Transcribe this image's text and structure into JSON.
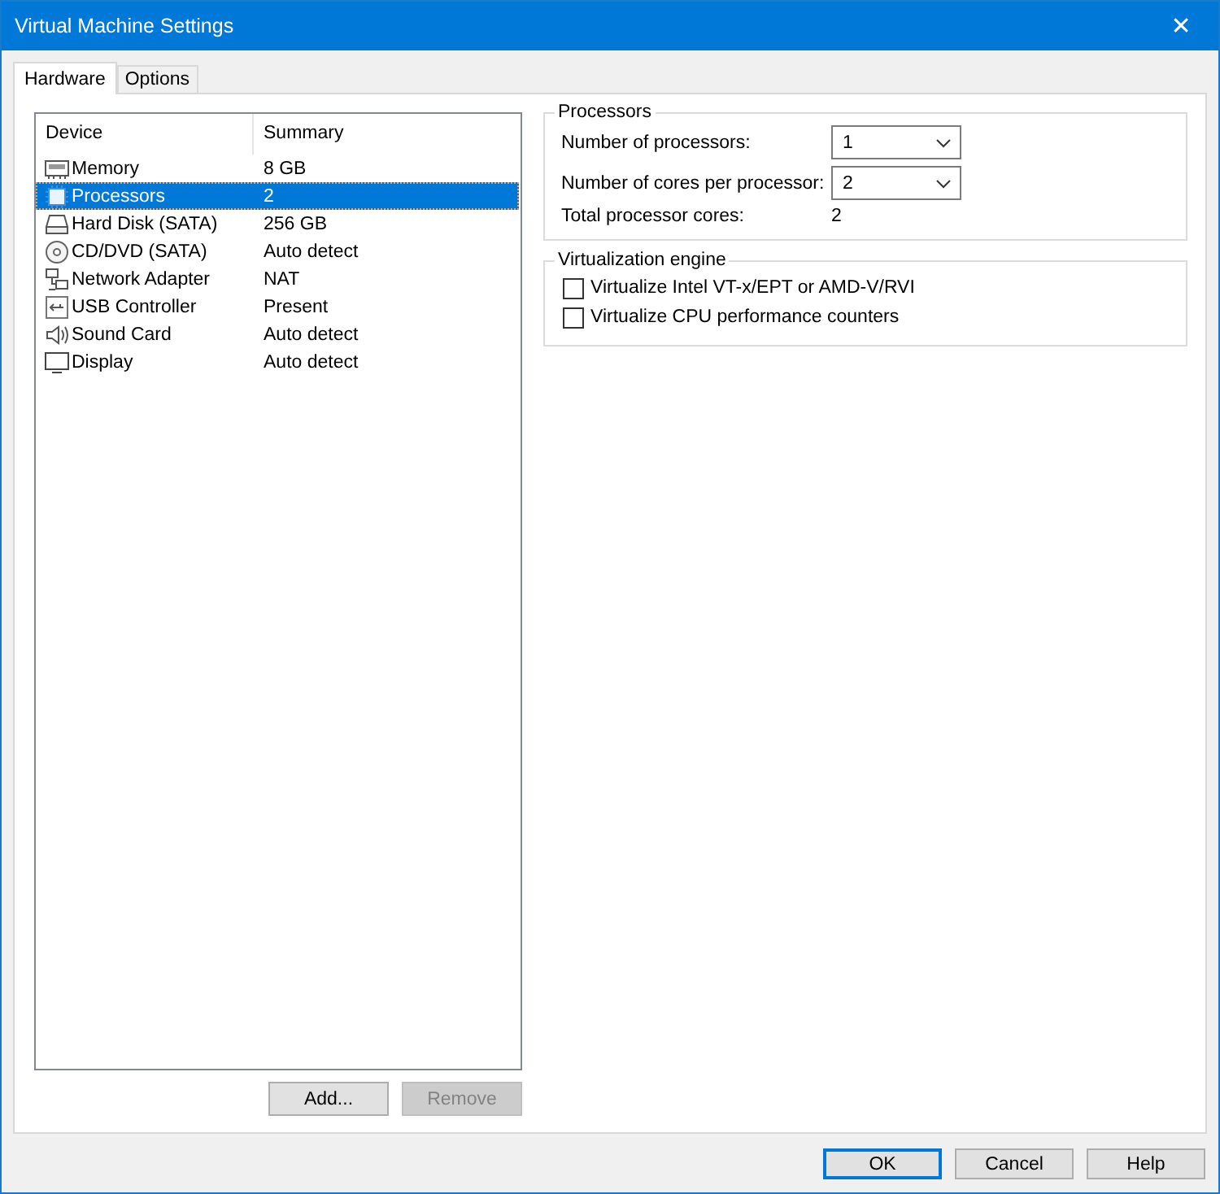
{
  "window": {
    "title": "Virtual Machine Settings",
    "close": "✕"
  },
  "tabs": [
    {
      "label": "Hardware",
      "selected": true
    },
    {
      "label": "Options",
      "selected": false
    }
  ],
  "device_list": {
    "columns": [
      "Device",
      "Summary"
    ],
    "rows": [
      {
        "kind": "memory",
        "device": "Memory",
        "summary": "8 GB",
        "selected": false
      },
      {
        "kind": "processor",
        "device": "Processors",
        "summary": "2",
        "selected": true
      },
      {
        "kind": "disk",
        "device": "Hard Disk (SATA)",
        "summary": "256 GB",
        "selected": false
      },
      {
        "kind": "cd",
        "device": "CD/DVD (SATA)",
        "summary": "Auto detect",
        "selected": false
      },
      {
        "kind": "network",
        "device": "Network Adapter",
        "summary": "NAT",
        "selected": false
      },
      {
        "kind": "usb",
        "device": "USB Controller",
        "summary": "Present",
        "selected": false
      },
      {
        "kind": "sound",
        "device": "Sound Card",
        "summary": "Auto detect",
        "selected": false
      },
      {
        "kind": "display",
        "device": "Display",
        "summary": "Auto detect",
        "selected": false
      }
    ]
  },
  "list_buttons": [
    {
      "label": "Add...",
      "disabled": false
    },
    {
      "label": "Remove",
      "disabled": true
    }
  ],
  "processors": {
    "title": "Processors",
    "number_of_processors": {
      "label": "Number of processors:",
      "value": "1"
    },
    "cores_per_processor": {
      "label": "Number of cores per processor:",
      "value": "2"
    },
    "total_cores": {
      "label": "Total processor cores:",
      "value": "2"
    }
  },
  "virtualization_engine": {
    "title": "Virtualization engine",
    "options": [
      {
        "label": "Virtualize Intel VT-x/EPT or AMD-V/RVI",
        "checked": false
      },
      {
        "label": "Virtualize CPU performance counters",
        "checked": false
      }
    ]
  },
  "buttons": [
    {
      "label": "OK",
      "default": true
    },
    {
      "label": "Cancel",
      "default": false
    },
    {
      "label": "Help",
      "default": false
    }
  ]
}
